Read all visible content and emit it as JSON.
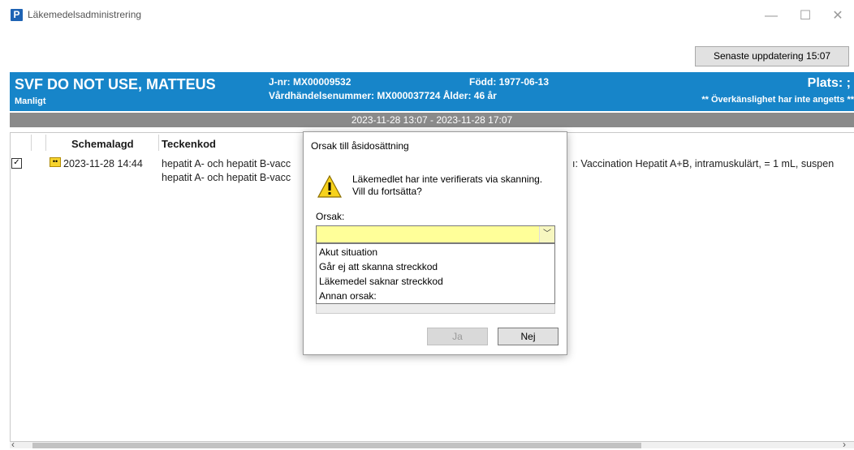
{
  "window": {
    "title": "Läkemedelsadministrering",
    "app_icon_letter": "P",
    "minimize": "—",
    "maximize": "☐",
    "close": "✕"
  },
  "toolbar": {
    "update_label": "Senaste uppdatering 15:07"
  },
  "patient": {
    "name": "SVF DO NOT USE, MATTEUS",
    "gender": "Manligt",
    "jnr": "J-nr: MX00009532",
    "vardhandelse": "Vårdhändelsenummer: MX000037724 Ålder: 46 år",
    "fodd": "Född: 1977-06-13",
    "plats": "Plats: ;",
    "allergy": "** Överkänslighet har inte angetts **"
  },
  "date_range": "2023-11-28 13:07  - 2023-11-28 17:07",
  "table": {
    "headers": {
      "schemalagd": "Schemalagd",
      "teckenkod": "Teckenkod"
    },
    "row": {
      "checked_mark": "✓",
      "time": "2023-11-28 14:44",
      "teckenkod_1": "hepatit A- och hepatit B-vacc",
      "teckenkod_2": "hepatit A- och hepatit B-vacc",
      "description": "ı: Vaccination Hepatit A+B, intramuskulärt, = 1 mL, suspen"
    },
    "scroll_left": "‹",
    "scroll_right": "›"
  },
  "dialog": {
    "title": "Orsak till åsidosättning",
    "message_line1": "Läkemedlet har inte verifierats via skanning.",
    "message_line2": "Vill du fortsätta?",
    "orsak_label": "Orsak:",
    "orsak_value": "",
    "options": [
      "Akut situation",
      "Går ej att skanna streckkod",
      "Läkemedel saknar streckkod",
      "Annan orsak:"
    ],
    "yes_label": "Ja",
    "no_label": "Nej"
  },
  "colors": {
    "header_blue": "#1785c9",
    "date_bar": "#8a8a8a",
    "combo_yellow": "#ffff99"
  }
}
